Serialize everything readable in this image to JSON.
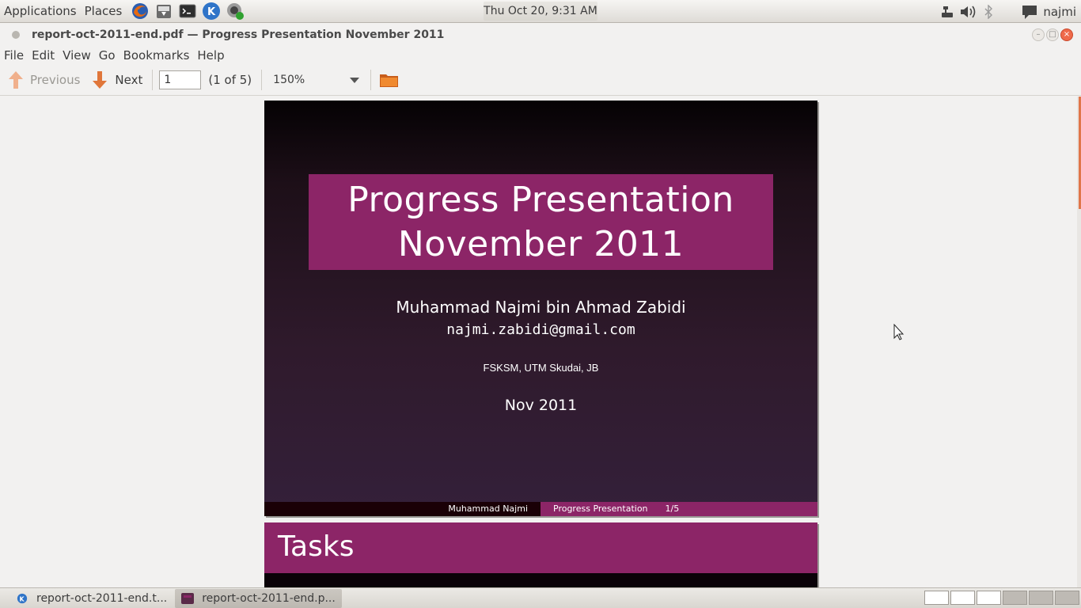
{
  "top_panel": {
    "menus": [
      "Applications",
      "Places"
    ],
    "launchers": [
      "firefox-icon",
      "download-manager-icon",
      "terminal-icon",
      "kde-icon",
      "webcam-icon"
    ],
    "clock": "Thu Oct 20,  9:31 AM",
    "user": "najmi"
  },
  "window": {
    "title": "report-oct-2011-end.pdf — Progress Presentation November 2011"
  },
  "menubar": [
    "File",
    "Edit",
    "View",
    "Go",
    "Bookmarks",
    "Help"
  ],
  "toolbar": {
    "previous_label": "Previous",
    "next_label": "Next",
    "page_value": "1",
    "page_count": "(1 of 5)",
    "zoom": "150%"
  },
  "slide1": {
    "title_line1": "Progress Presentation",
    "title_line2": "November 2011",
    "author": "Muhammad Najmi bin Ahmad Zabidi",
    "email": "najmi.zabidi@gmail.com",
    "institute": "FSKSM, UTM Skudai, JB",
    "date": "Nov 2011",
    "footer_author": "Muhammad Najmi",
    "footer_title": "Progress Presentation",
    "footer_page": "1/5"
  },
  "slide2": {
    "title": "Tasks"
  },
  "taskbar": {
    "items": [
      "report-oct-2011-end.t...",
      "report-oct-2011-end.p..."
    ]
  },
  "colors": {
    "accent": "#8c2567",
    "arrow": "#e0763a"
  }
}
